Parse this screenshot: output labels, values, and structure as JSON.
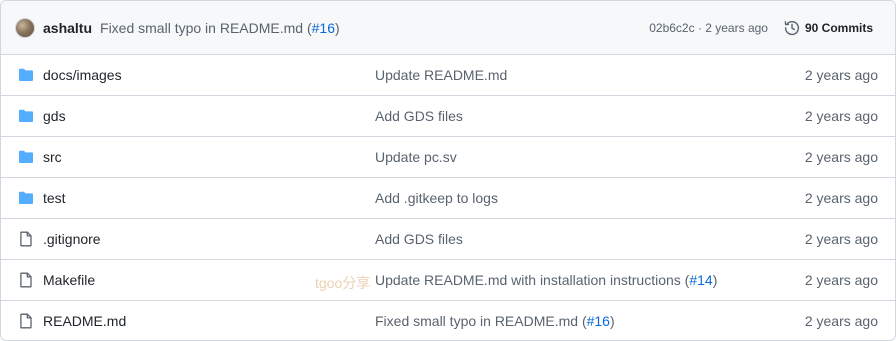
{
  "latest_commit": {
    "author": "ashaltu",
    "message_prefix": "Fixed small typo in README.md (",
    "pr_link": "#16",
    "message_suffix": ")",
    "sha_time": "02b6c2c · 2 years ago",
    "history_label": "90 Commits"
  },
  "rows": [
    {
      "type": "folder",
      "name": "docs/images",
      "message": "Update README.md",
      "pr": "",
      "message_end": "",
      "age": "2 years ago"
    },
    {
      "type": "folder",
      "name": "gds",
      "message": "Add GDS files",
      "pr": "",
      "message_end": "",
      "age": "2 years ago"
    },
    {
      "type": "folder",
      "name": "src",
      "message": "Update pc.sv",
      "pr": "",
      "message_end": "",
      "age": "2 years ago"
    },
    {
      "type": "folder",
      "name": "test",
      "message": "Add .gitkeep to logs",
      "pr": "",
      "message_end": "",
      "age": "2 years ago"
    },
    {
      "type": "file",
      "name": ".gitignore",
      "message": "Add GDS files",
      "pr": "",
      "message_end": "",
      "age": "2 years ago"
    },
    {
      "type": "file",
      "name": "Makefile",
      "message": "Update README.md with installation instructions (",
      "pr": "#14",
      "message_end": ")",
      "age": "2 years ago"
    },
    {
      "type": "file",
      "name": "README.md",
      "message": "Fixed small typo in README.md (",
      "pr": "#16",
      "message_end": ")",
      "age": "2 years ago"
    }
  ],
  "watermark": "tgoo分享",
  "colors": {
    "folder": "#54aeff",
    "file_icon": "#59636e",
    "link": "#0969da",
    "muted": "#59636e",
    "border": "#d0d7de"
  }
}
